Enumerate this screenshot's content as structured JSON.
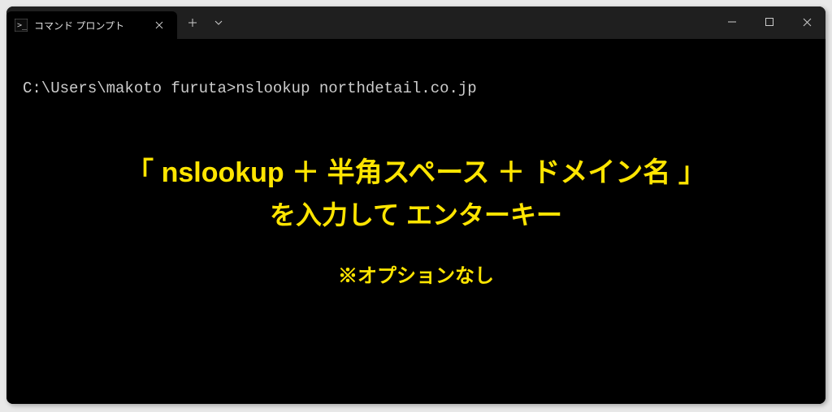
{
  "window": {
    "tab_label": "コマンド プロンプト"
  },
  "terminal": {
    "prompt": "C:\\Users\\makoto furuta>",
    "command": "nslookup northdetail.co.jp"
  },
  "annotation": {
    "line1": "「 nslookup ＋ 半角スペース ＋ ドメイン名 」",
    "line2": "を入力して エンターキー",
    "line3": "※オプションなし"
  },
  "colors": {
    "annotation_text": "#ffe500"
  }
}
